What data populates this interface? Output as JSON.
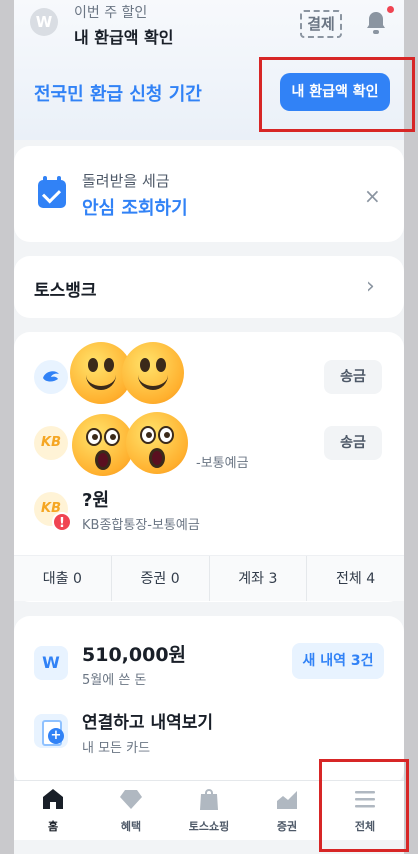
{
  "header": {
    "subtitle": "이번 주 할인",
    "title": "내 환급액 확인",
    "pay_label": "결제",
    "won_symbol": "W"
  },
  "refund_banner": {
    "text": "전국민 환급 신청 기간",
    "button": "내 환급액 확인"
  },
  "tax_card": {
    "subtitle": "돌려받을 세금",
    "title": "안심 조회하기",
    "close": "×"
  },
  "bank_card": {
    "title": "토스뱅크",
    "chevron": "›"
  },
  "accounts": {
    "send_label": "송금",
    "account2_name_partial": "-보통예금",
    "account3_amount": "?원",
    "account3_name": "KB종합통장-보통예금",
    "kb_logo": "KB",
    "warning": "!",
    "tabs": [
      {
        "label": "대출",
        "count": "0"
      },
      {
        "label": "증권",
        "count": "0"
      },
      {
        "label": "계좌",
        "count": "3"
      },
      {
        "label": "전체",
        "count": "4"
      }
    ]
  },
  "spending_card": {
    "amount": "510,000원",
    "subtitle": "5월에 쓴 돈",
    "new_button": "새 내역 3건",
    "icon_symbol": "W",
    "link_title": "연결하고 내역보기",
    "link_subtitle": "내 모든 카드"
  },
  "bottom_nav": {
    "items": [
      {
        "label": "홈",
        "icon": "home-icon"
      },
      {
        "label": "혜택",
        "icon": "diamond-icon"
      },
      {
        "label": "토스쇼핑",
        "icon": "shopping-bag-icon"
      },
      {
        "label": "증권",
        "icon": "chart-icon"
      },
      {
        "label": "전체",
        "icon": "menu-icon"
      }
    ]
  },
  "colors": {
    "accent": "#3182f6",
    "highlight_box": "#d72626",
    "alert": "#f04452"
  }
}
